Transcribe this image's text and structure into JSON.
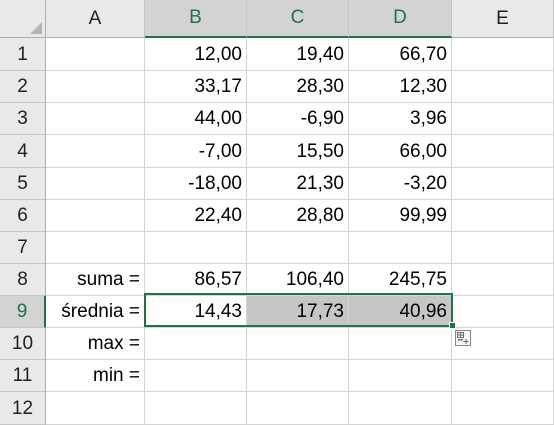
{
  "columns": [
    "A",
    "B",
    "C",
    "D",
    "E"
  ],
  "rows": [
    "1",
    "2",
    "3",
    "4",
    "5",
    "6",
    "7",
    "8",
    "9",
    "10",
    "11",
    "12"
  ],
  "cells": {
    "B1": "12,00",
    "C1": "19,40",
    "D1": "66,70",
    "B2": "33,17",
    "C2": "28,30",
    "D2": "12,30",
    "B3": "44,00",
    "C3": "-6,90",
    "D3": "3,96",
    "B4": "-7,00",
    "C4": "15,50",
    "D4": "66,00",
    "B5": "-18,00",
    "C5": "21,30",
    "D5": "-3,20",
    "B6": "22,40",
    "C6": "28,80",
    "D6": "99,99",
    "A8": "suma =",
    "B8": "86,57",
    "C8": "106,40",
    "D8": "245,75",
    "A9": "średnia =",
    "B9": "14,43",
    "C9": "17,73",
    "D9": "40,96",
    "A10": "max =",
    "A11": "min ="
  },
  "selection": {
    "range": "B9:D9",
    "active_cell": "B9",
    "selected_columns": [
      "B",
      "C",
      "D"
    ],
    "selected_row": "9",
    "accent_color": "#217346",
    "selected_fill_color": "#c6c6c6"
  },
  "icons": {
    "select_all": "select-all-triangle-icon",
    "fill_handle": "fill-handle-icon",
    "quick_analysis": "quick-analysis-icon"
  }
}
